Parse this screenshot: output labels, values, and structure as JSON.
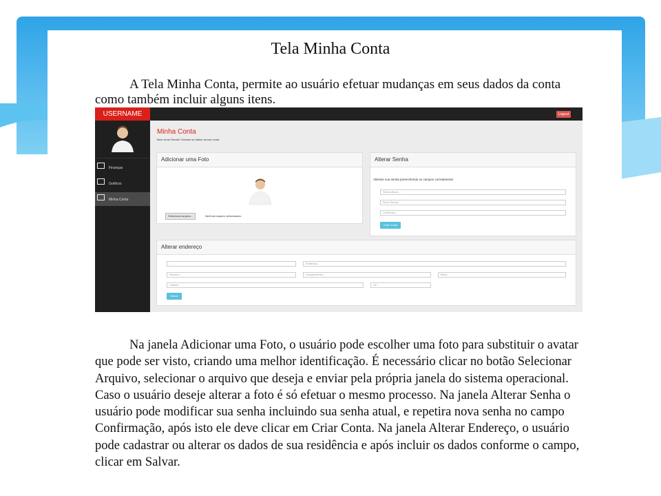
{
  "document": {
    "title": "Tela Minha Conta",
    "intro": "A Tela Minha Conta, permite ao usuário efetuar mudanças em seus dados da conta como também incluir alguns itens.",
    "body": "Na janela Adicionar uma Foto, o usuário pode escolher uma foto para substituir o avatar que pode ser visto, criando uma melhor identificação. É necessário clicar no botão Selecionar Arquivo, selecionar o arquivo que deseja e enviar pela própria janela do sistema operacional. Caso o usuário deseje alterar a foto é só efetuar o mesmo processo. Na janela Alterar Senha o usuário pode modificar sua senha incluindo sua senha atual, e repetira nova senha no campo Confirmação, após isto ele deve clicar em Criar Conta. Na janela Alterar Endereço, o usuário pode cadastrar ou alterar os dados de sua residência e após incluir os dados conforme o campo, clicar em Salvar."
  },
  "app": {
    "brand": "USERNAME",
    "logout": "Logout",
    "sidebar": [
      {
        "label": "Finanças",
        "icon": "table-icon"
      },
      {
        "label": "Gráficos",
        "icon": "bar-chart-icon"
      },
      {
        "label": "Minha Conta",
        "icon": "monitor-icon"
      }
    ],
    "header": {
      "title": "Minha Conta",
      "subtitle": "Bem vindo Ronald ! Acesse os dados da sua conta"
    },
    "photo_panel": {
      "title": "Adicionar uma Foto",
      "file_button": "Selecionar arquivo...",
      "file_status": "Nenhum arquivo selecionado."
    },
    "password_panel": {
      "title": "Alterar Senha",
      "note": "Alterare sua senha preenchendo os campos corretamente",
      "current_placeholder": "Senha Atual...",
      "new_placeholder": "Nova Senha...",
      "confirm_placeholder": "Confirmac...",
      "submit": "Criar Conta"
    },
    "address_panel": {
      "title": "Alterar endereço",
      "fields": [
        "...",
        "Endereço...",
        "Numero...",
        "Complemento...",
        "Bairo...",
        "Cidade...",
        "UF..."
      ],
      "submit": "Salvar"
    },
    "colors": {
      "brand": "#d9201a",
      "accent": "#5bc0de",
      "sidebar": "#1f1f1f"
    }
  }
}
